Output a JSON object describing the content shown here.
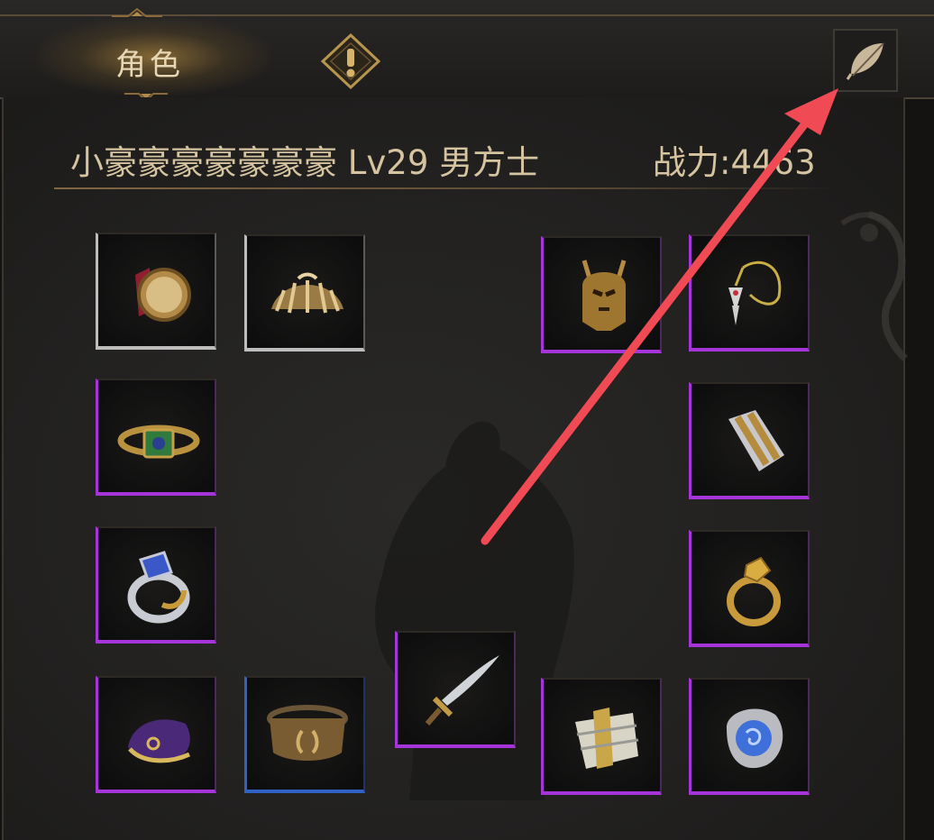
{
  "tabs": {
    "character_label": "角色"
  },
  "character": {
    "name": "小豪豪豪豪豪豪豪",
    "level": "Lv29",
    "gender_class": "男方士",
    "power_label": "战力:",
    "power_value": "4463"
  },
  "colors": {
    "quality_white": "#bdbdbd",
    "quality_purple": "#a535d8",
    "quality_blue": "#2f62c4",
    "annotation_arrow": "#f04a55"
  },
  "equipment_slots": [
    {
      "icon": "medal-icon",
      "quality": "white"
    },
    {
      "icon": "shoulder-icon",
      "quality": "white"
    },
    {
      "icon": "helmet-icon",
      "quality": "purple"
    },
    {
      "icon": "necklace-icon",
      "quality": "purple"
    },
    {
      "icon": "bracelet-icon",
      "quality": "purple"
    },
    {
      "icon": "bracer-icon",
      "quality": "purple"
    },
    {
      "icon": "sapphire-ring-icon",
      "quality": "purple"
    },
    {
      "icon": "gold-ring-icon",
      "quality": "purple"
    },
    {
      "icon": "sword-icon",
      "quality": "purple"
    },
    {
      "icon": "shoes-icon",
      "quality": "purple"
    },
    {
      "icon": "belt-icon",
      "quality": "blue"
    },
    {
      "icon": "armor-icon",
      "quality": "purple"
    },
    {
      "icon": "talisman-icon",
      "quality": "purple"
    }
  ]
}
